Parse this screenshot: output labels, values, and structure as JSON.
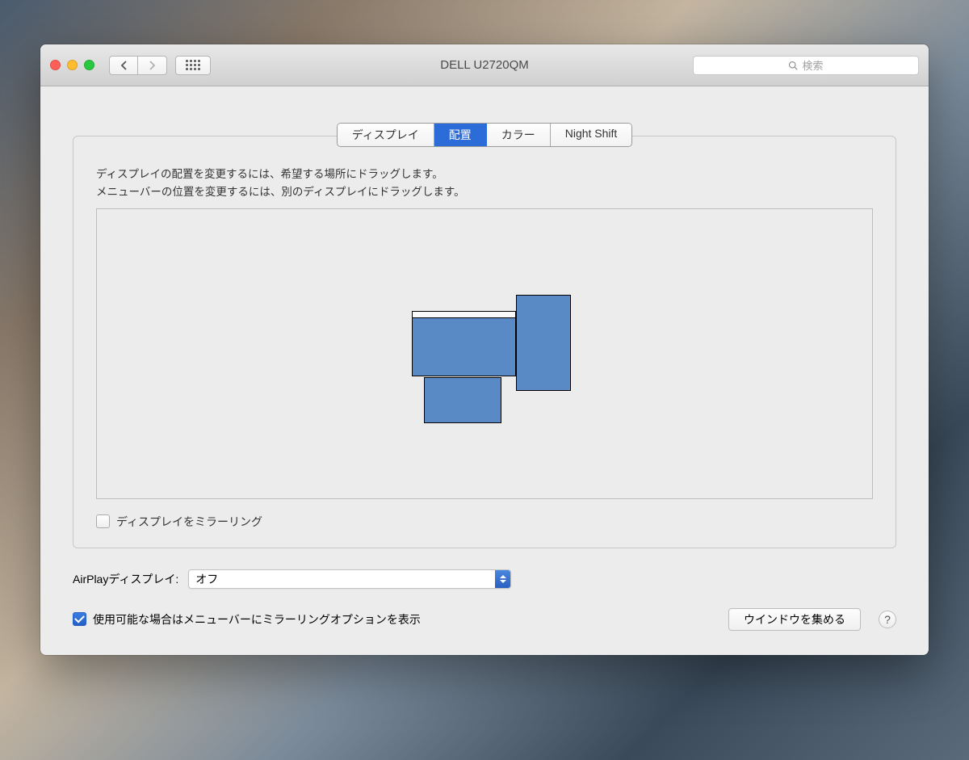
{
  "window": {
    "title": "DELL U2720QM",
    "search_placeholder": "検索"
  },
  "tabs": {
    "display": "ディスプレイ",
    "arrangement": "配置",
    "color": "カラー",
    "nightshift": "Night Shift",
    "active": "arrangement"
  },
  "instructions": {
    "line1": "ディスプレイの配置を変更するには、希望する場所にドラッグします。",
    "line2": "メニューバーの位置を変更するには、別のディスプレイにドラッグします。"
  },
  "mirror": {
    "label": "ディスプレイをミラーリング",
    "checked": false
  },
  "airplay": {
    "label": "AirPlayディスプレイ:",
    "value": "オフ"
  },
  "show_in_menubar": {
    "label": "使用可能な場合はメニューバーにミラーリングオプションを表示",
    "checked": true
  },
  "gather_windows": "ウインドウを集める",
  "help": "?"
}
